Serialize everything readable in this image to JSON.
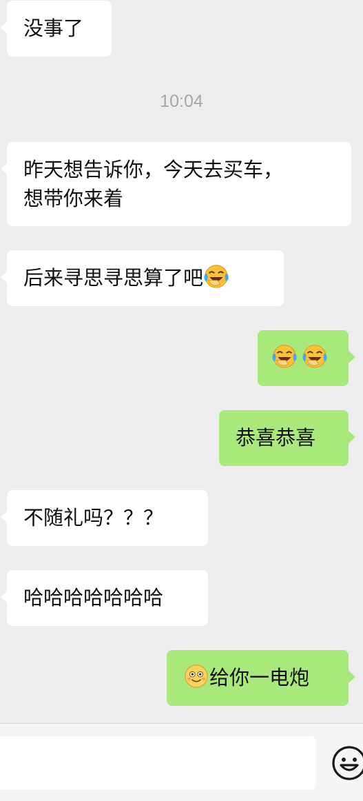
{
  "messages": [
    {
      "side": "in",
      "text": "没事了"
    },
    {
      "type": "timestamp",
      "text": "10:04"
    },
    {
      "side": "in",
      "line1": "昨天想告诉你，今天去买车，",
      "line2": "想带你来着"
    },
    {
      "side": "in",
      "text": "后来寻思寻思算了吧",
      "emoji": "laugh-cry-emoji"
    },
    {
      "side": "out",
      "emoji_count": 2,
      "emoji": "laugh-cry-emoji"
    },
    {
      "side": "out",
      "text": "恭喜恭喜"
    },
    {
      "side": "in",
      "text": "不随礼吗？？？"
    },
    {
      "side": "in",
      "text": "哈哈哈哈哈哈哈"
    },
    {
      "side": "out",
      "text": "给你一电炮",
      "emoji": "smile-emoji"
    }
  ],
  "timestamp": "10:04",
  "colors": {
    "background": "#ededed",
    "incoming_bubble": "#ffffff",
    "outgoing_bubble": "#a9e97b",
    "timestamp_text": "#a6a6a6"
  },
  "input_bar": {
    "value": "",
    "emoji_button": "emoji-face-icon"
  }
}
